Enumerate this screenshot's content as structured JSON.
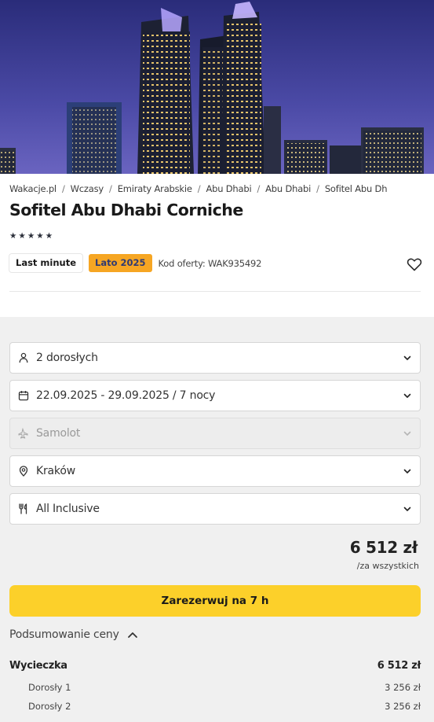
{
  "hero": {
    "image_alt": "Abu Dhabi skyline at night"
  },
  "breadcrumb": [
    "Wakacje.pl",
    "Wczasy",
    "Emiraty Arabskie",
    "Abu Dhabi",
    "Abu Dhabi",
    "Sofitel Abu Dh"
  ],
  "hotel": {
    "name": "Sofitel Abu Dhabi Corniche",
    "stars": 5
  },
  "tags": {
    "last_minute": "Last minute",
    "season": "Lato 2025",
    "offer_code": "Kod oferty: WAK935492"
  },
  "form": {
    "travelers": "2 dorosłych",
    "dates": "22.09.2025 - 29.09.2025 / 7 nocy",
    "transport": "Samolot",
    "departure": "Kraków",
    "board": "All Inclusive"
  },
  "price": {
    "total": "6 512 zł",
    "note": "/za wszystkich"
  },
  "cta": {
    "label": "Zarezerwuj na 7 h"
  },
  "summary": {
    "toggle_label": "Podsumowanie ceny",
    "trip_label": "Wycieczka",
    "trip_total": "6 512 zł",
    "items": [
      {
        "label": "Dorosły 1",
        "value": "3 256 zł"
      },
      {
        "label": "Dorosły 2",
        "value": "3 256 zł"
      }
    ]
  },
  "colors": {
    "accent": "#fcd02a",
    "season_tag": "#f6a623",
    "panel_bg": "#f0f0f0"
  }
}
